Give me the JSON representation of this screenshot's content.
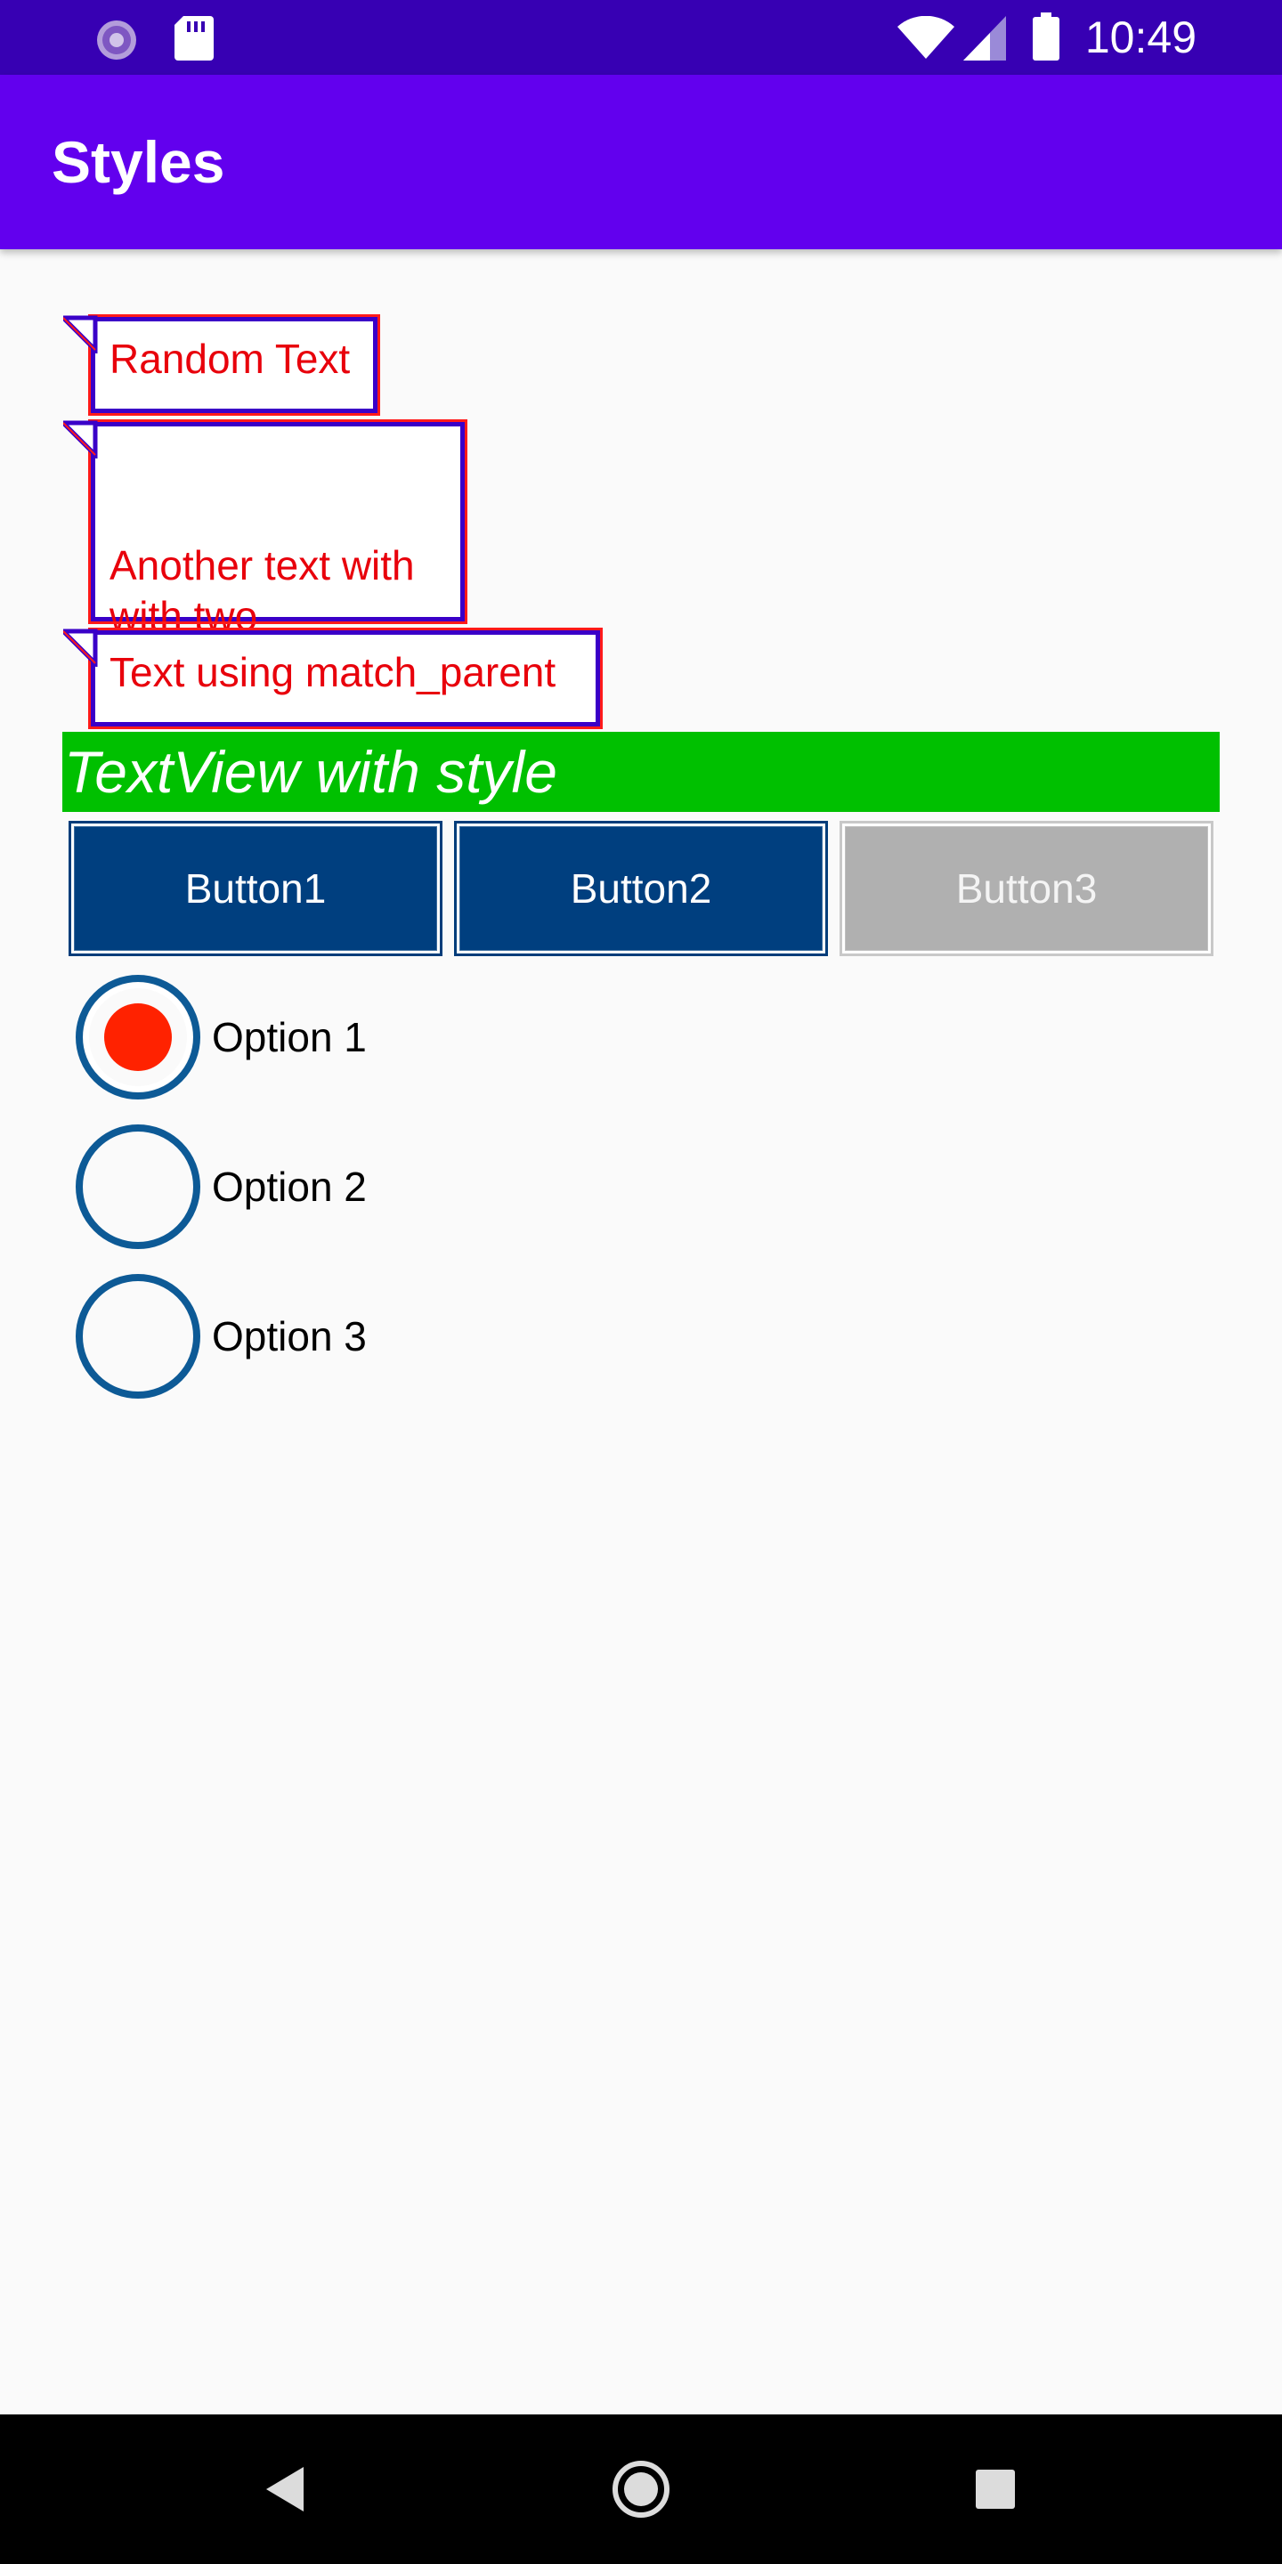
{
  "status_bar": {
    "time": "10:49",
    "background": "#3700b3",
    "icons": [
      "sync-icon",
      "sd-card-icon",
      "wifi-icon",
      "cell-signal-icon",
      "battery-icon"
    ]
  },
  "app_bar": {
    "title": "Styles",
    "background": "#6200ee"
  },
  "callouts": [
    {
      "text": "Random Text"
    },
    {
      "text": "Another text with\nwith two\nlines"
    },
    {
      "text": "Text using match_parent"
    }
  ],
  "styled_textview": {
    "text": "TextView with style",
    "background": "#00c000"
  },
  "buttons": [
    {
      "label": "Button1",
      "enabled": true
    },
    {
      "label": "Button2",
      "enabled": true
    },
    {
      "label": "Button3",
      "enabled": false
    }
  ],
  "radio_options": [
    {
      "label": "Option 1",
      "checked": true
    },
    {
      "label": "Option 2",
      "checked": false
    },
    {
      "label": "Option 3",
      "checked": false
    }
  ],
  "colors": {
    "callout_text": "#e8000b",
    "callout_border": "#3a00c8",
    "button_bg": "#003f7f",
    "button_disabled_bg": "#b0b0b0",
    "radio_ring": "#0d5a96",
    "radio_dot": "#ff2200"
  },
  "nav_bar": {
    "icons": [
      "back-icon",
      "home-icon",
      "recents-icon"
    ]
  }
}
